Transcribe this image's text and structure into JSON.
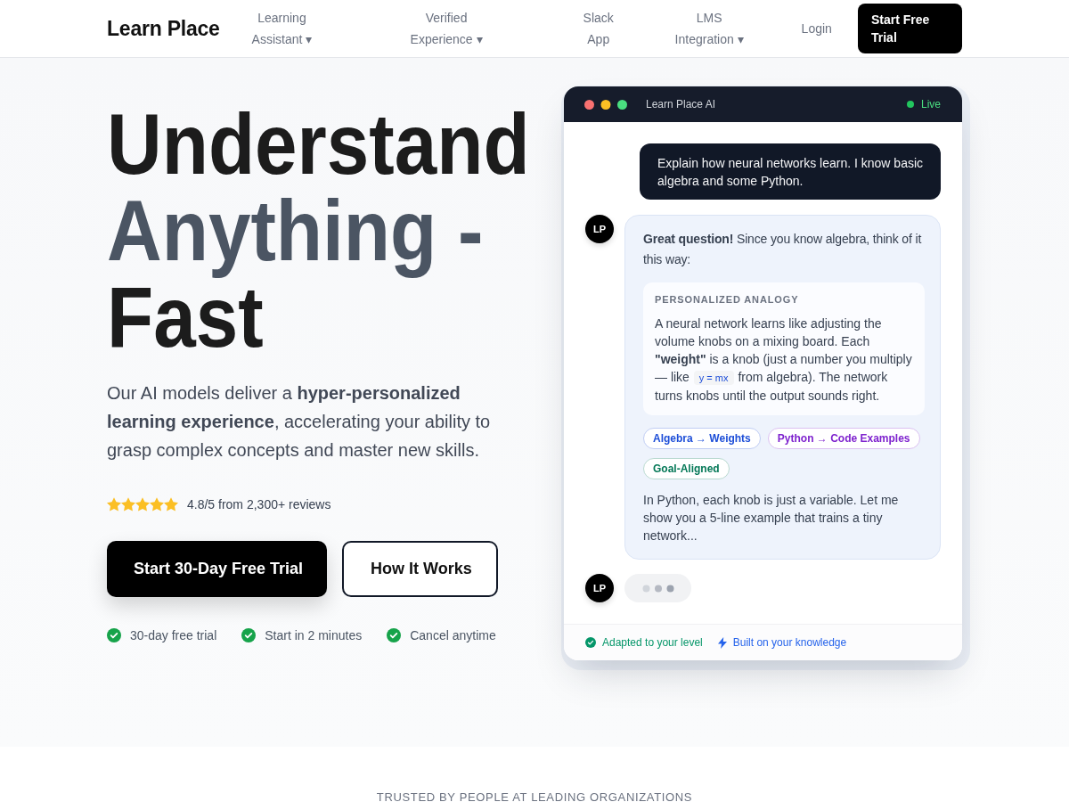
{
  "nav": {
    "logo": "Learn Place",
    "items": [
      {
        "label": "Learning Assistant",
        "caret": "▾"
      },
      {
        "label": "Verified Experience",
        "caret": "▾"
      },
      {
        "label": "Slack App"
      },
      {
        "label": "LMS Integration",
        "caret": "▾"
      },
      {
        "label": "Login"
      }
    ],
    "cta": "Start Free Trial"
  },
  "hero": {
    "headline": [
      {
        "text": "Understand",
        "accent": false
      },
      {
        "text": "Anything -",
        "accent": true
      },
      {
        "text": "Fast",
        "accent": false
      }
    ],
    "subtitle": "Our AI models deliver a **hyper-personalized learning experience**, accelerating your ability to grasp complex concepts and master new skills.",
    "rating": {
      "stars": 5,
      "text": "4.8/5 from 2,300+ reviews"
    },
    "buttons": [
      {
        "label": "Start 30-Day Free Trial",
        "kind": "primary"
      },
      {
        "label": "How It Works",
        "kind": "secondary"
      }
    ],
    "perks": [
      "30-day free trial",
      "Start in 2 minutes",
      "Cancel anytime"
    ]
  },
  "chat": {
    "title": "Learn Place AI",
    "status": "Live",
    "messages": [
      {
        "kind": "user",
        "text": "Explain how neural networks learn. I know basic algebra and some Python."
      },
      {
        "kind": "assistant",
        "avatar": "LP",
        "intro": "**Great question!** Since you know algebra, think of it this way:",
        "analogy": {
          "label": "PERSONALIZED ANALOGY",
          "text_before": "A neural network learns like adjusting the volume knobs on a mixing board. Each **\"weight\"** is a knob (just a number you multiply — like ",
          "code": "y = mx",
          "text_after": " from algebra). The network turns knobs until the output sounds right."
        },
        "tags": [
          {
            "label": "Algebra → Weights",
            "color": "#1d4ed8"
          },
          {
            "label": "Python → Code Examples",
            "color": "#7e22ce"
          },
          {
            "label": "Goal-Aligned",
            "color": "#047857"
          }
        ],
        "text": "In Python, each knob is just a variable. Let me show you a 5-line example that trains a tiny network..."
      },
      {
        "kind": "typing",
        "avatar": "LP"
      }
    ],
    "footer": [
      {
        "kind": "check",
        "text": "Adapted to your level",
        "color": "#059669"
      },
      {
        "kind": "bolt",
        "text": "Built on your knowledge",
        "color": "#2563eb"
      }
    ]
  },
  "trusted": {
    "heading": "TRUSTED BY PEOPLE AT LEADING ORGANIZATIONS"
  }
}
